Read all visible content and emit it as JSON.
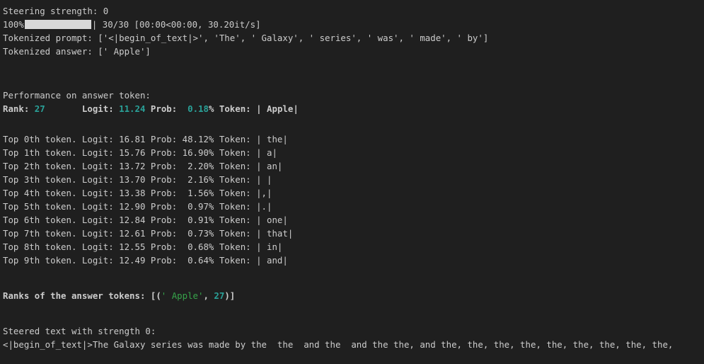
{
  "cell_output": {
    "steering_line": "Steering strength: 0",
    "progress": {
      "percent_label": "100%",
      "fill_fraction": 1.0,
      "stats": "| 30/30 [00:00<00:00, 30.20it/s]"
    },
    "tokenized_prompt": "Tokenized prompt: ['<|begin_of_text|>', 'The', ' Galaxy', ' series', ' was', ' made', ' by']",
    "tokenized_answer": "Tokenized answer: [' Apple']",
    "performance_header": "Performance on answer token:",
    "answer_perf": {
      "rank_label": "Rank: ",
      "rank_value": "27",
      "logit_label": "       Logit: ",
      "logit_value": "11.24",
      "prob_label": " Prob:  ",
      "prob_value": "0.18",
      "token_part": "% Token: | Apple|"
    },
    "top_tokens": [
      "Top 0th token. Logit: 16.81 Prob: 48.12% Token: | the|",
      "Top 1th token. Logit: 15.76 Prob: 16.90% Token: | a|",
      "Top 2th token. Logit: 13.72 Prob:  2.20% Token: | an|",
      "Top 3th token. Logit: 13.70 Prob:  2.16% Token: | |",
      "Top 4th token. Logit: 13.38 Prob:  1.56% Token: |,|",
      "Top 5th token. Logit: 12.90 Prob:  0.97% Token: |.|",
      "Top 6th token. Logit: 12.84 Prob:  0.91% Token: | one|",
      "Top 7th token. Logit: 12.61 Prob:  0.73% Token: | that|",
      "Top 8th token. Logit: 12.55 Prob:  0.68% Token: | in|",
      "Top 9th token. Logit: 12.49 Prob:  0.64% Token: | and|"
    ],
    "ranks": {
      "prefix": "Ranks of the answer tokens: [(",
      "token_str": "' Apple'",
      "sep": ", ",
      "rank": "27",
      "suffix": ")]"
    },
    "steered_header": "Steered text with strength 0:",
    "steered_text": "<|begin_of_text|>The Galaxy series was made by the  the  and the  and the the, and the, the, the, the, the, the, the, the, the,"
  },
  "colors": {
    "background": "#1f1f1f",
    "text": "#cccccc",
    "number_cyan": "#2aa198",
    "string_green": "#36a34a"
  }
}
